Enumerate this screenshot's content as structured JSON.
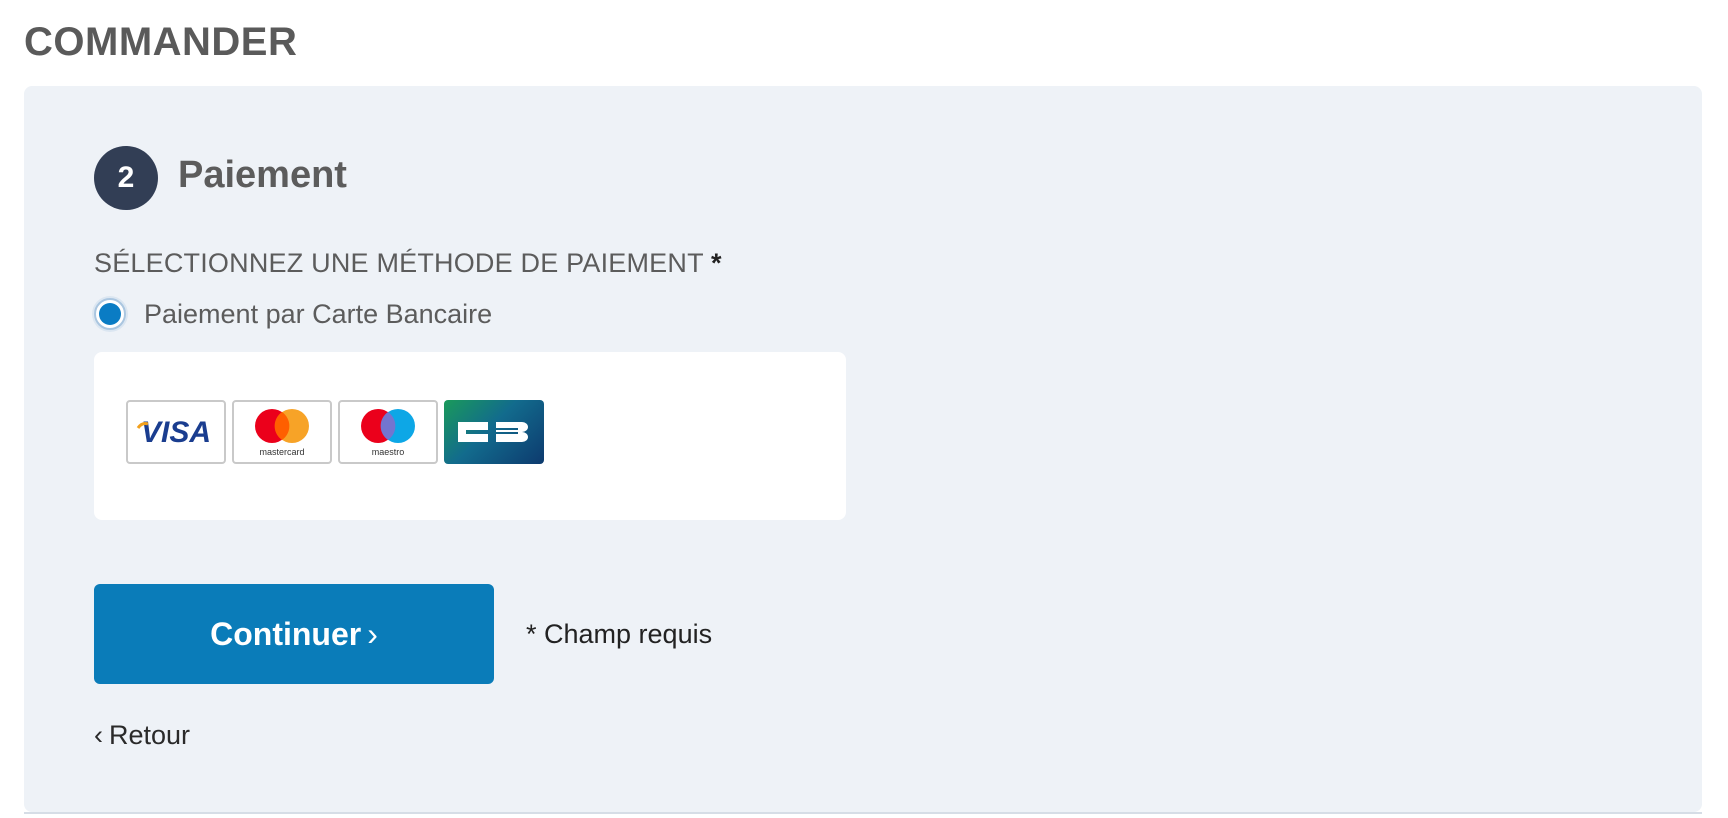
{
  "page": {
    "title": "COMMANDER"
  },
  "step": {
    "number": "2",
    "title": "Paiement"
  },
  "payment": {
    "section_label": "SÉLECTIONNEZ UNE MÉTHODE DE PAIEMENT",
    "required_marker": "*",
    "options": [
      {
        "label": "Paiement par Carte Bancaire",
        "selected": true
      }
    ],
    "cards": [
      {
        "name": "visa-icon",
        "text": "VISA"
      },
      {
        "name": "mastercard-icon",
        "text": "mastercard"
      },
      {
        "name": "maestro-icon",
        "text": "maestro"
      },
      {
        "name": "cb-icon",
        "text": ""
      }
    ]
  },
  "actions": {
    "continue_label": "Continuer",
    "continue_chevron": "›",
    "required_note": "* Champ requis",
    "back_chevron": "‹",
    "back_label": "Retour"
  },
  "colors": {
    "panel_bg": "#eef2f7",
    "step_circle": "#323e55",
    "primary_button": "#0a7cb9",
    "radio_selected": "#0a7cc4"
  }
}
